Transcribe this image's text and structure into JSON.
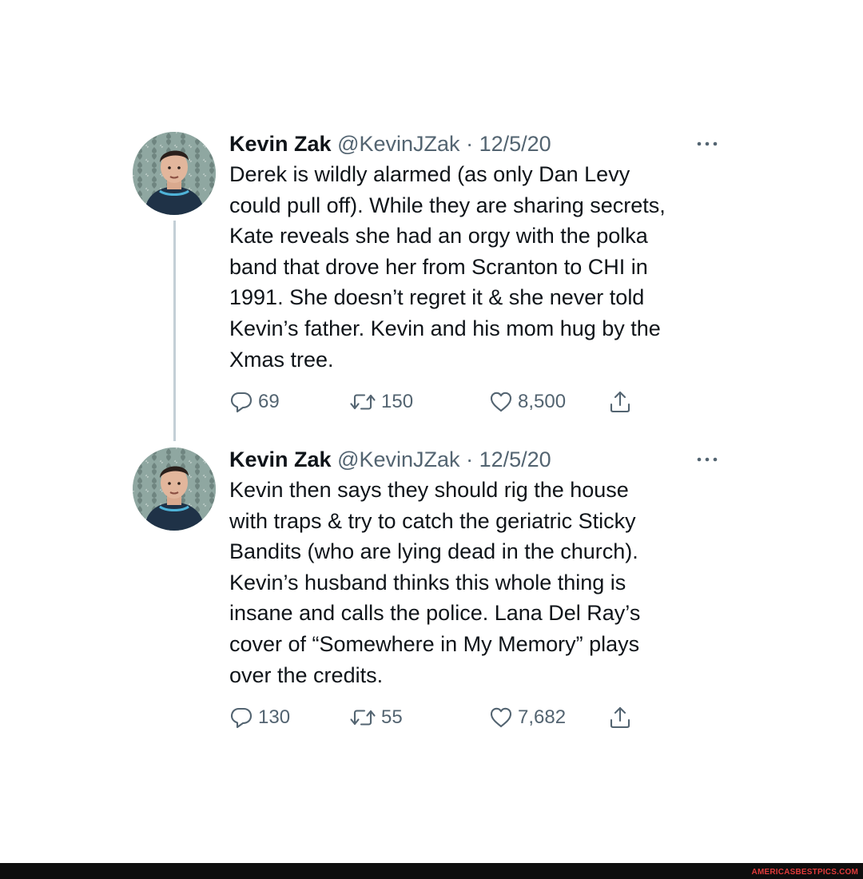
{
  "tweets": [
    {
      "author": {
        "name": "Kevin Zak",
        "handle": "@KevinJZak"
      },
      "separator": "·",
      "date": "12/5/20",
      "text_lines": [
        "Derek is wildly alarmed (as only Dan Levy",
        "could pull off). While they are sharing secrets,",
        "Kate reveals she had an orgy with the polka",
        "band that drove her from Scranton to CHI in",
        "1991. She doesn’t regret it & she never told",
        "Kevin’s father. Kevin and his mom hug by the",
        "Xmas tree."
      ],
      "stats": {
        "replies": "69",
        "retweets": "150",
        "likes": "8,500"
      }
    },
    {
      "author": {
        "name": "Kevin Zak",
        "handle": "@KevinJZak"
      },
      "separator": "·",
      "date": "12/5/20",
      "text_lines": [
        "Kevin then says they should rig the house",
        "with traps & try to catch the geriatric Sticky",
        "Bandits (who are lying dead in the church).",
        "Kevin’s husband thinks this whole thing is",
        "insane and calls the police. Lana Del Ray’s",
        "cover of “Somewhere in My Memory” plays",
        "over the credits."
      ],
      "stats": {
        "replies": "130",
        "retweets": "55",
        "likes": "7,682"
      }
    }
  ],
  "icons": {
    "more": "more-dots-icon",
    "reply": "reply-bubble-icon",
    "retweet": "retweet-arrows-icon",
    "like": "heart-icon",
    "share": "share-upload-icon"
  },
  "colors": {
    "text": "#0f1419",
    "secondary": "#536471",
    "thread_line": "#c4cfd6"
  },
  "watermark": "AMERICASBESTPICS.COM"
}
